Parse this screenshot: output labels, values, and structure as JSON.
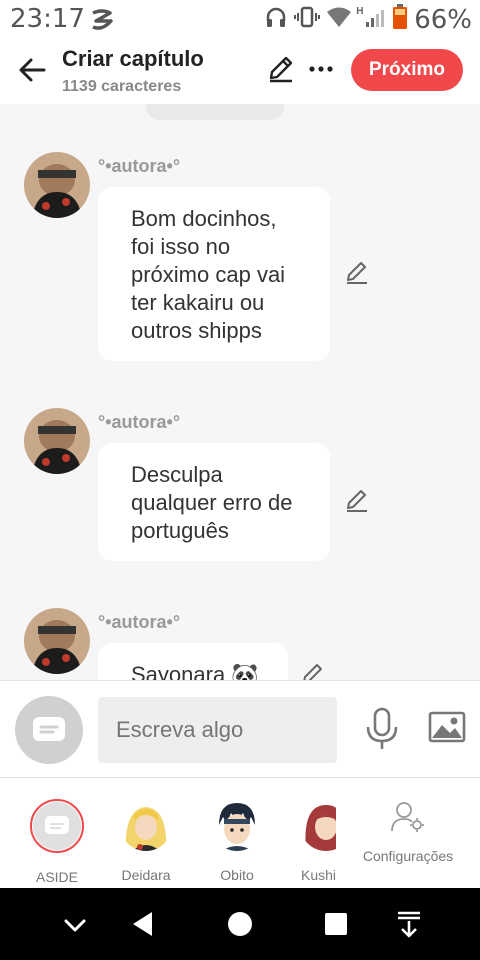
{
  "status_bar": {
    "time": "23:17",
    "battery": "66%",
    "network_label": "H",
    "icons": [
      "app-notification-icon",
      "headphones-icon",
      "vibrate-icon",
      "wifi-icon",
      "signal-icon",
      "battery-icon"
    ]
  },
  "header": {
    "title": "Criar capítulo",
    "subtitle": "1139 caracteres",
    "next_label": "Próximo",
    "accent": "#f0484b"
  },
  "messages": [
    {
      "author": "°•autora•°",
      "lines": [
        "Bom docinhos,",
        "foi isso no",
        "próximo cap vai",
        "ter kakairu ou",
        "outros shipps"
      ]
    },
    {
      "author": "°•autora•°",
      "lines": [
        "Desculpa",
        "qualquer erro de",
        "português"
      ]
    },
    {
      "author": "°•autora•°",
      "lines": [
        "Sayonara 🐼"
      ]
    }
  ],
  "composer": {
    "placeholder": "Escreva algo"
  },
  "characters": [
    {
      "name": "ASIDE"
    },
    {
      "name": "Deidara"
    },
    {
      "name": "Obito"
    },
    {
      "name": "Kushi"
    }
  ],
  "settings_label": "Configurações"
}
